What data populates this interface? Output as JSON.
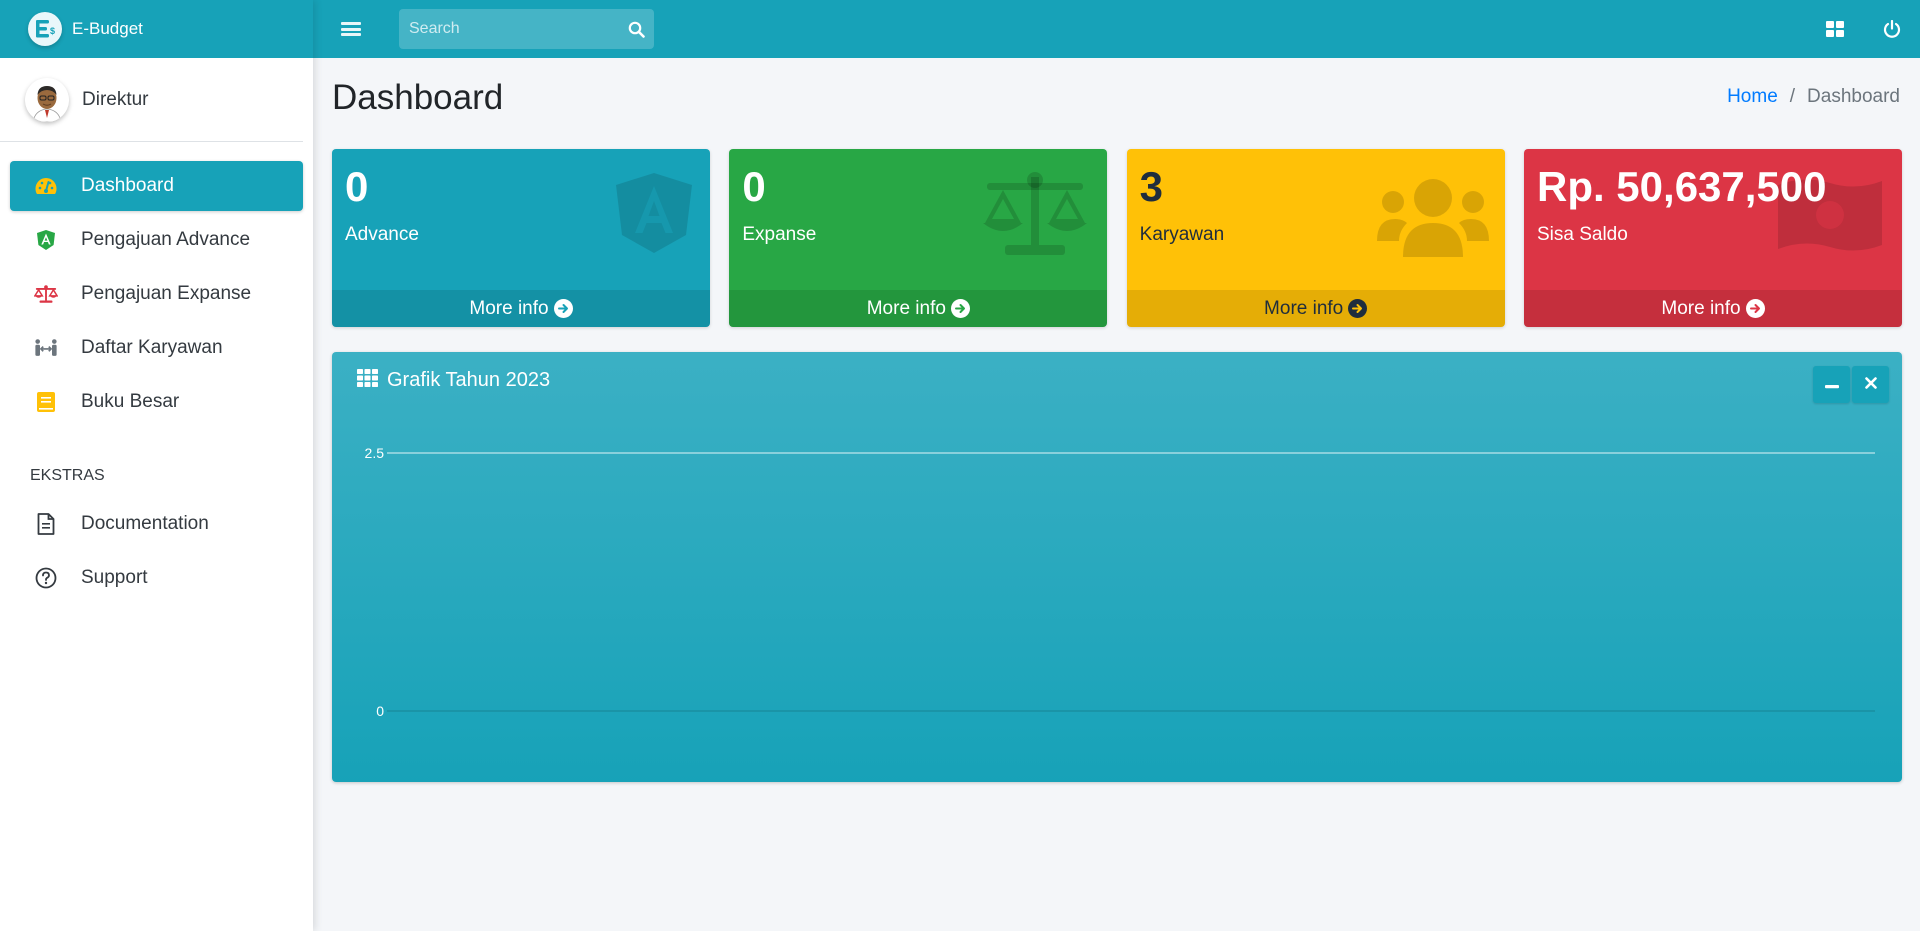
{
  "brand": {
    "name": "E-Budget"
  },
  "user": {
    "name": "Direktur"
  },
  "sidebar": {
    "items": [
      {
        "label": "Dashboard",
        "icon": "tachometer-icon",
        "color": "#ffc107",
        "active": true
      },
      {
        "label": "Pengajuan Advance",
        "icon": "angular-shield-icon",
        "color": "#28a745"
      },
      {
        "label": "Pengajuan Expanse",
        "icon": "balance-scale-icon",
        "color": "#dc3545"
      },
      {
        "label": "Daftar Karyawan",
        "icon": "people-arrows-icon",
        "color": "#6c757d"
      },
      {
        "label": "Buku Besar",
        "icon": "book-icon",
        "color": "#ffc107"
      }
    ],
    "extras_header": "EKSTRAS",
    "extras": [
      {
        "label": "Documentation",
        "icon": "file-text-icon"
      },
      {
        "label": "Support",
        "icon": "question-circle-icon"
      }
    ]
  },
  "topbar": {
    "search_placeholder": "Search"
  },
  "page": {
    "title": "Dashboard"
  },
  "breadcrumb": {
    "home": "Home",
    "current": "Dashboard"
  },
  "boxes": [
    {
      "value": "0",
      "label": "Advance",
      "footer": "More info",
      "color": "#17a2b8",
      "icon": "angular-icon"
    },
    {
      "value": "0",
      "label": "Expanse",
      "footer": "More info",
      "color": "#28a745",
      "icon": "balance-scale-icon"
    },
    {
      "value": "3",
      "label": "Karyawan",
      "footer": "More info",
      "color": "#ffc107",
      "icon": "users-icon"
    },
    {
      "value": "Rp. 50,637,500",
      "label": "Sisa Saldo",
      "footer": "More info",
      "color": "#dc3545",
      "icon": "money-bill-icon"
    }
  ],
  "chart_card": {
    "title": "Grafik Tahun 2023"
  },
  "chart_data": {
    "type": "line",
    "title": "Grafik Tahun 2023",
    "x": [],
    "series": [],
    "ylim": [
      0,
      2.5
    ],
    "yticks": [
      "2.5",
      "0"
    ],
    "grid": true
  }
}
